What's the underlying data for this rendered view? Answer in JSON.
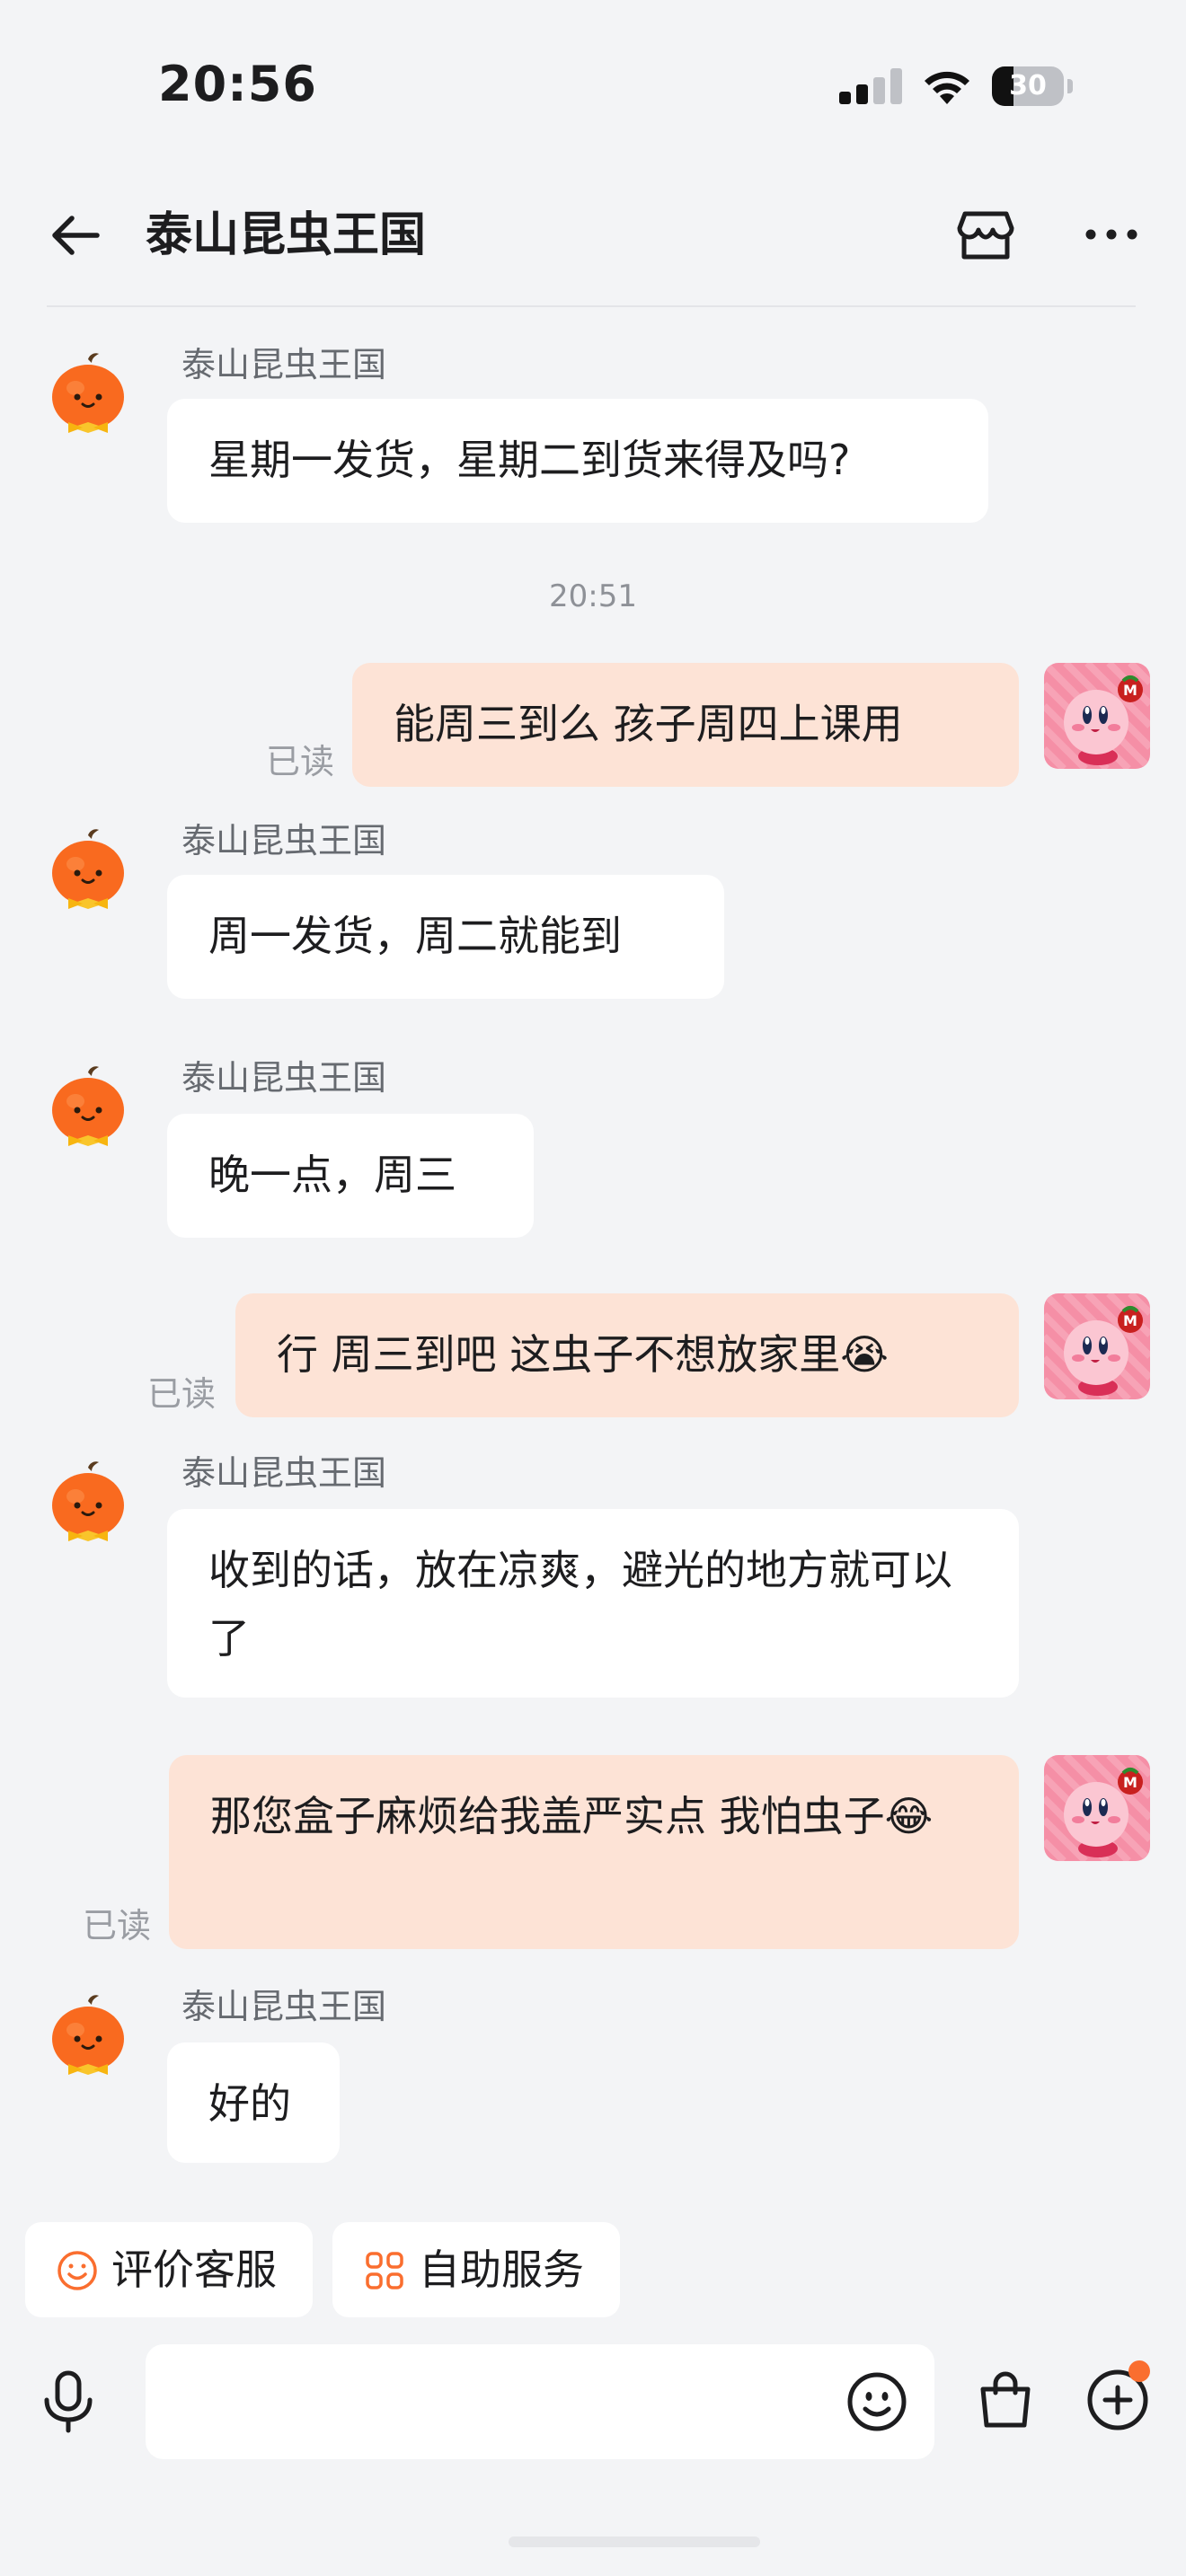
{
  "status_bar": {
    "time": "20:56",
    "battery": "30",
    "battery_level": 0.3
  },
  "header": {
    "title": "泰山昆虫王国"
  },
  "colors": {
    "accent": "#fa6e2f",
    "outgoing_bubble": "#fde3d6",
    "incoming_bubble": "#ffffff",
    "background": "#f3f4f6"
  },
  "icons": {
    "back": "arrow-left-icon",
    "store": "store-icon",
    "more": "more-dots-icon",
    "shop_avatar": "pumpkin-mascot-icon",
    "user_avatar": "kirby-avatar-icon",
    "rate": "smile-icon",
    "self_service": "grid-icon",
    "mic": "mic-icon",
    "emoji": "emoji-icon",
    "bag": "shopping-bag-icon",
    "plus": "plus-circle-icon"
  },
  "messages": [
    {
      "from": "shop",
      "sender": "泰山昆虫王国",
      "text": "星期一发货，星期二到货来得及吗?"
    },
    {
      "type": "time",
      "text": "20:51"
    },
    {
      "from": "user",
      "read": "已读",
      "text": "能周三到么 孩子周四上课用"
    },
    {
      "from": "shop",
      "sender": "泰山昆虫王国",
      "text": "周一发货，周二就能到"
    },
    {
      "from": "shop",
      "sender": "泰山昆虫王国",
      "text": "晚一点，周三"
    },
    {
      "from": "user",
      "read": "已读",
      "text": "行 周三到吧 这虫子不想放家里😭"
    },
    {
      "from": "shop",
      "sender": "泰山昆虫王国",
      "text": "收到的话，放在凉爽，避光的地方就可以了"
    },
    {
      "from": "user",
      "read": "已读",
      "text": "那您盒子麻烦给我盖严实点 我怕虫子😂"
    },
    {
      "from": "shop",
      "sender": "泰山昆虫王国",
      "text": "好的"
    }
  ],
  "quick_actions": [
    {
      "label": "评价客服"
    },
    {
      "label": "自助服务"
    }
  ],
  "input": {
    "placeholder": "",
    "value": ""
  }
}
